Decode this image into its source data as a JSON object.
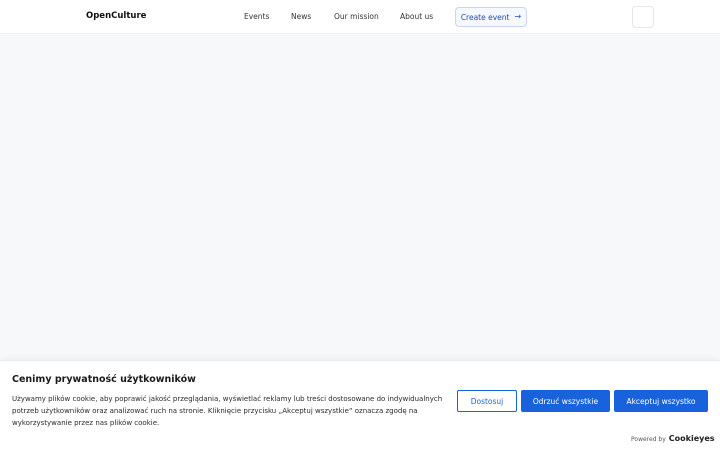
{
  "header": {
    "logo": "OpenCulture",
    "nav": [
      {
        "label": "Events"
      },
      {
        "label": "News"
      },
      {
        "label": "Our mission"
      },
      {
        "label": "About us"
      }
    ],
    "create_event_label": "Create event",
    "create_event_icon": "arrow-right-icon"
  },
  "cookie_banner": {
    "title": "Cenimy prywatność użytkowników",
    "text": "Używamy plików cookie, aby poprawić jakość przeglądania, wyświetlać reklamy lub treści dostosowane do indywidualnych potrzeb użytkowników oraz analizować ruch na stronie. Kliknięcie przycisku „Akceptuj wszystkie” oznacza zgodę na wykorzystywanie przez nas plików cookie.",
    "buttons": {
      "customize": "Dostosuj",
      "reject": "Odrzuć wszystkie",
      "accept": "Akceptuj wszystko"
    },
    "powered_by_label": "Powered by",
    "powered_by_brand": "Cookieyes"
  },
  "colors": {
    "accent": "#1863dc",
    "page_background": "#f7f8fa"
  }
}
